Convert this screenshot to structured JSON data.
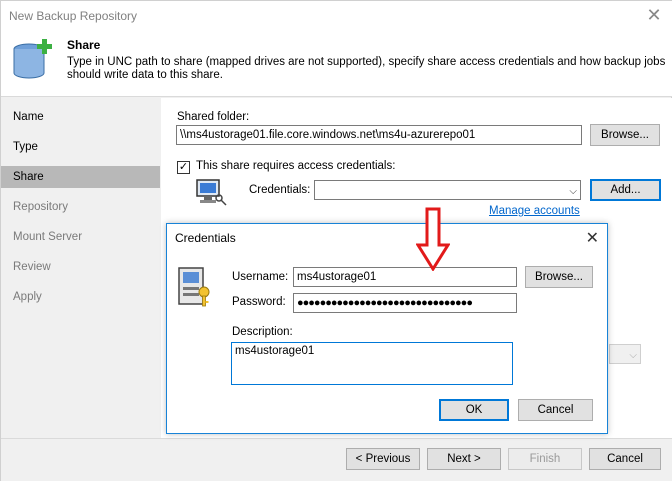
{
  "window": {
    "title": "New Backup Repository",
    "close_glyph": "✕"
  },
  "header": {
    "icon": "database-add-icon",
    "heading": "Share",
    "description": "Type in UNC path to share (mapped drives are not supported), specify share access credentials and how backup jobs should write data to this share."
  },
  "sidebar": {
    "items": [
      {
        "label": "Name",
        "state": "done"
      },
      {
        "label": "Type",
        "state": "done"
      },
      {
        "label": "Share",
        "state": "active"
      },
      {
        "label": "Repository",
        "state": "pending"
      },
      {
        "label": "Mount Server",
        "state": "pending"
      },
      {
        "label": "Review",
        "state": "pending"
      },
      {
        "label": "Apply",
        "state": "pending"
      }
    ]
  },
  "share": {
    "shared_folder_label": "Shared folder:",
    "shared_folder_value": "\\\\ms4ustorage01.file.core.windows.net\\ms4u-azurerepo01",
    "browse_label": "Browse...",
    "requires_credentials_label": "This share requires access credentials:",
    "requires_credentials_checked": true,
    "check_glyph": "✓",
    "credentials_label": "Credentials:",
    "credentials_value": "",
    "combo_arrow": "⌵",
    "add_label": "Add...",
    "manage_accounts_label": "Manage accounts"
  },
  "footer": {
    "previous_label": "< Previous",
    "next_label": "Next >",
    "finish_label": "Finish",
    "cancel_label": "Cancel"
  },
  "credentials_dialog": {
    "title": "Credentials",
    "close_glyph": "✕",
    "icon": "user-key-icon",
    "username_label": "Username:",
    "username_value": "ms4ustorage01",
    "browse_label": "Browse...",
    "password_label": "Password:",
    "password_mask": "●●●●●●●●●●●●●●●●●●●●●●●●●●●●●●●",
    "description_label": "Description:",
    "description_value": "ms4ustorage01",
    "ok_label": "OK",
    "cancel_label": "Cancel"
  },
  "annotation": {
    "icon": "red-down-arrow-icon",
    "color": "#e21a1a"
  },
  "colors": {
    "accent": "#0078d7",
    "link": "#0066cc",
    "active_nav": "#b8b8b8"
  }
}
